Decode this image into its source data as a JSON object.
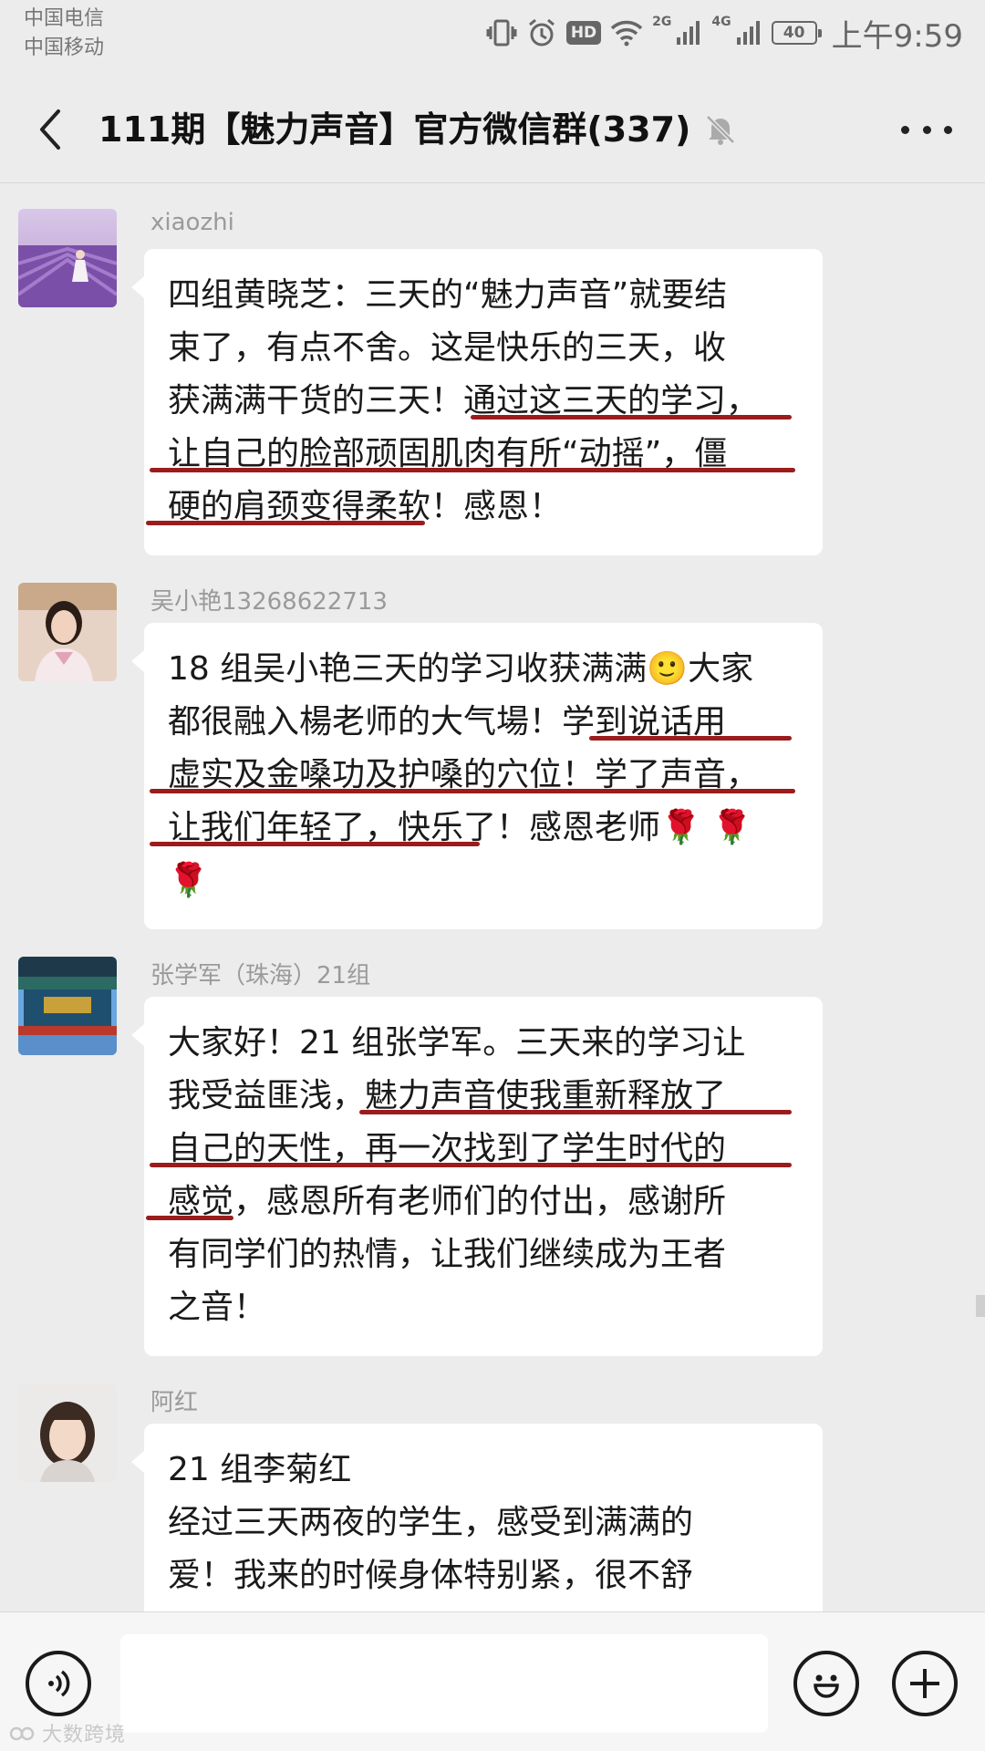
{
  "status_bar": {
    "carrier_1": "中国电信",
    "carrier_2": "中国移动",
    "hd": "HD",
    "net_2g": "2G",
    "net_4g": "4G",
    "battery": "40",
    "time": "上午9:59",
    "icons": [
      "vibrate-icon",
      "alarm-icon",
      "hd-icon",
      "wifi-icon",
      "signal-icon",
      "signal-icon",
      "battery-icon"
    ]
  },
  "nav": {
    "title": "111期【魅力声音】官方微信群(337)",
    "back_icon": "chevron-left-icon",
    "mute_icon": "bell-muted-icon",
    "more_icon": "more-icon"
  },
  "messages": [
    {
      "sender": "xiaozhi",
      "lines": [
        "四组黄晓芝：三天的“魅力声音”就要结",
        "束了，有点不舍。这是快乐的三天，收",
        "获满满干货的三天！通过这三天的学习，",
        "让自己的脸部顽固肌肉有所“动摇”，僵",
        "硬的肩颈变得柔软！感恩！"
      ]
    },
    {
      "sender": "吴小艳13268622713",
      "lines": [
        "18 组吴小艳三天的学习收获满满🙂大家",
        "都很融入楊老师的大气場！学到说话用",
        "虚实及金嗓功及护嗓的穴位！学了声音，",
        "让我们年轻了，快乐了！感恩老师🌹 🌹",
        "🌹"
      ]
    },
    {
      "sender": "张学军（珠海）21组",
      "lines": [
        "大家好！21 组张学军。三天来的学习让",
        "我受益匪浅，魅力声音使我重新释放了",
        "自己的天性，再一次找到了学生时代的",
        "感觉，感恩所有老师们的付出，感谢所",
        "有同学们的热情，让我们继续成为王者",
        "之音！"
      ]
    },
    {
      "sender": "阿红",
      "lines": [
        "21 组李菊红",
        "经过三天两夜的学生，感受到满满的",
        "爱！我来的时候身体特别紧，很不舒"
      ]
    }
  ],
  "input_bar": {
    "voice_icon": "voice-icon",
    "emoji_icon": "emoji-icon",
    "plus_icon": "plus-icon",
    "placeholder": ""
  },
  "watermark": "大数跨境",
  "colors": {
    "background": "#ececec",
    "bubble": "#ffffff",
    "underline": "#9b1c1c",
    "sender_name": "#9a9a9a"
  }
}
